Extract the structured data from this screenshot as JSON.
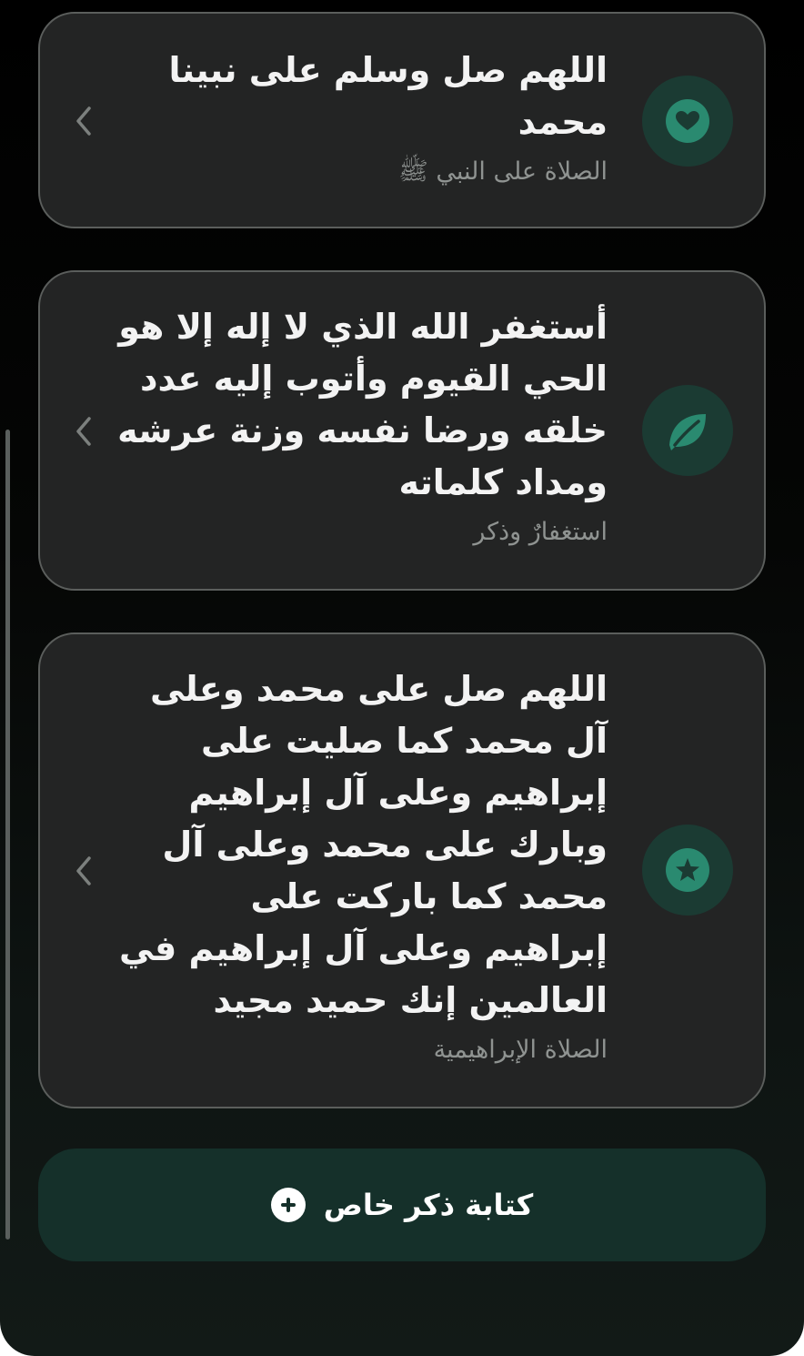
{
  "dhikr_list": [
    {
      "text": "اللهم صل وسلم على نبينا محمد",
      "label": "الصلاة على النبي ﷺ",
      "icon": "heart-icon"
    },
    {
      "text": "أستغفر الله الذي لا إله إلا هو الحي القيوم وأتوب إليه عدد خلقه ورضا نفسه وزنة عرشه ومداد كلماته",
      "label": "استغفارٌ وذكر",
      "icon": "leaf-icon"
    },
    {
      "text": "اللهم صل على محمد وعلى آل محمد كما صليت على إبراهيم وعلى آل إبراهيم وبارك على محمد وعلى آل محمد كما باركت على إبراهيم وعلى آل إبراهيم في العالمين إنك حميد مجيد",
      "label": "الصلاة الإبراهيمية",
      "icon": "star-icon"
    }
  ],
  "add_button": {
    "label": "كتابة ذكر خاص",
    "icon": "plus-icon"
  },
  "colors": {
    "accent": "#2a8a70",
    "icon_bg": "#1b3b33",
    "card_bg": "#232424",
    "add_button_bg": "#15302a"
  }
}
